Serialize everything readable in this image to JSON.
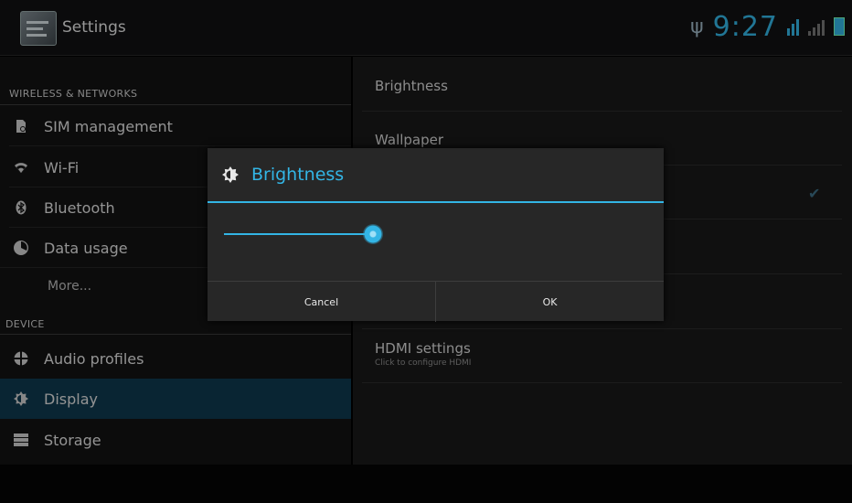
{
  "actionbar": {
    "title": "Settings",
    "clock": "9:27"
  },
  "sidebar": {
    "wireless_header": "WIRELESS & NETWORKS",
    "device_header": "DEVICE",
    "items": [
      {
        "label": "SIM management",
        "icon": "sim-icon"
      },
      {
        "label": "Wi-Fi",
        "icon": "wifi-icon"
      },
      {
        "label": "Bluetooth",
        "icon": "bluetooth-icon"
      },
      {
        "label": "Data usage",
        "icon": "data-usage-icon"
      },
      {
        "label": "More...",
        "icon": ""
      },
      {
        "label": "Audio profiles",
        "icon": "audio-profiles-icon"
      },
      {
        "label": "Display",
        "icon": "display-icon"
      },
      {
        "label": "Storage",
        "icon": "storage-icon"
      }
    ]
  },
  "content": {
    "brightness": "Brightness",
    "wallpaper": "Wallpaper",
    "hdmi_title": "HDMI settings",
    "hdmi_sub": "Click to configure HDMI"
  },
  "dialog": {
    "title": "Brightness",
    "brightness_level": 0.43,
    "cancel": "Cancel",
    "ok": "OK"
  },
  "colors": {
    "accent": "#33b5e5",
    "selected_bg": "#0e3a4f"
  }
}
